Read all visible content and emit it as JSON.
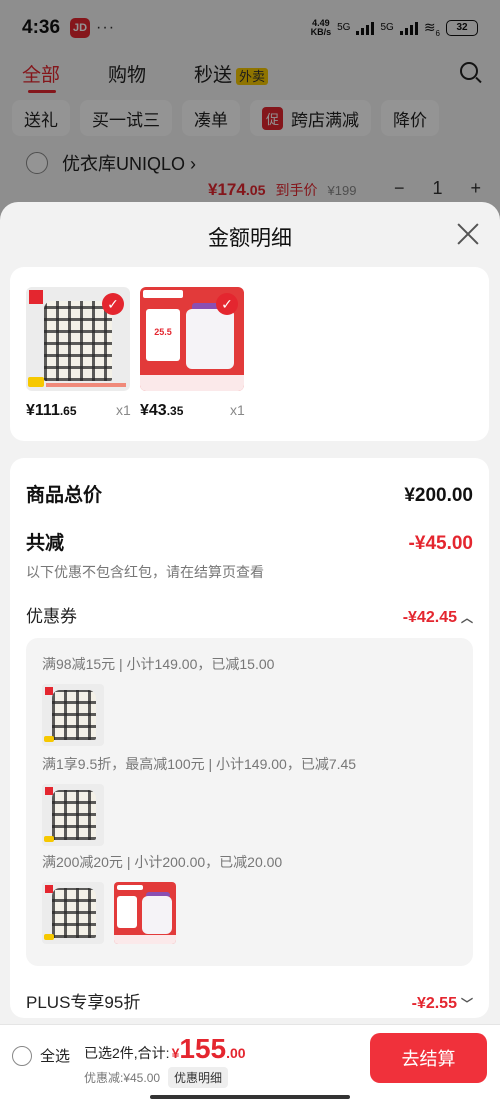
{
  "status_bar": {
    "time": "4:36",
    "app_icon_text": "JD",
    "dots": "···",
    "speed": "4.49\nKB/s",
    "net1": "5G",
    "net2": "5G",
    "wifi": "6",
    "battery": "32"
  },
  "top_tabs": [
    {
      "label": "全部",
      "active": true
    },
    {
      "label": "购物",
      "active": false
    },
    {
      "label": "秒送",
      "badge": "外卖",
      "active": false
    }
  ],
  "chips": [
    {
      "label": "送礼"
    },
    {
      "label": "买一试三"
    },
    {
      "label": "凑单"
    },
    {
      "label": "跨店满减",
      "prefix": "促"
    },
    {
      "label": "降价"
    }
  ],
  "shop": {
    "name": "优衣库UNIQLO",
    "arrow": "›",
    "price_prefix": "¥",
    "price": "174",
    "price_dec": ".05",
    "price_label": "到手价",
    "orig_price": "¥199",
    "qty": "1",
    "minus": "−",
    "plus": "+"
  },
  "sheet": {
    "title": "金额明细",
    "products": [
      {
        "price_prefix": "¥",
        "price_int": "111",
        "price_dec": ".65",
        "qty": "x1",
        "kind": "shirt"
      },
      {
        "price_prefix": "¥",
        "price_int": "43",
        "price_dec": ".35",
        "qty": "x1",
        "kind": "vitamin"
      }
    ],
    "check_glyph": "✓",
    "total_label": "商品总价",
    "total_value": "¥200.00",
    "reduce_label": "共减",
    "reduce_value": "-¥45.00",
    "reduce_note": "以下优惠不包含红包，请在结算页查看",
    "coupon_label": "优惠券",
    "coupon_value": "-¥42.45",
    "coupon_lines": [
      "满98减15元 | 小计149.00，已减15.00",
      "满1享9.5折，最高减100元 | 小计149.00，已减7.45",
      "满200减20元 | 小计200.00，已减20.00"
    ],
    "vita_thumb_text": "25.5",
    "plus_label": "PLUS专享95折",
    "plus_value": "-¥2.55"
  },
  "bottom": {
    "select_all": "全选",
    "summary_prefix": "已选2件,合计:",
    "currency": "¥",
    "total_int": "155",
    "total_dec": ".00",
    "discount_text": "优惠减:¥45.00",
    "detail_link": "优惠明细",
    "checkout": "去结算"
  },
  "colors": {
    "accent": "#e4262f",
    "checkout": "#f0313b"
  }
}
